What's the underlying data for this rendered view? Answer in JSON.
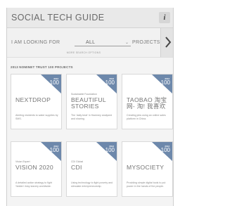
{
  "app": {
    "title": "SOCIAL TECH GUIDE",
    "info_label": "i"
  },
  "filter": {
    "prefix": "I AM LOOKING FOR",
    "selected": "ALL",
    "suffix": "PROJECTS.",
    "more_options": "MORE SEARCH OPTIONS"
  },
  "section": {
    "label": "2013 NOMINET TRUST 100 PROJECTS"
  },
  "colors": {
    "corner_blue": "#6d88ab",
    "title_bar": "#e9e9e9"
  },
  "cards": [
    {
      "org": "",
      "title": "NEXTDROP",
      "desc": "Alerting residents to water supplies by SMS.",
      "rank_year": "2013",
      "rank_num": "100",
      "rank_sub": "NOMINET TRUST"
    },
    {
      "org": "Sustainable Foundation",
      "title": "BEAUTIFUL STORIES",
      "desc": "The 'daily beat' in Hackney analysed and sharing.",
      "rank_year": "2013",
      "rank_num": "100",
      "rank_sub": "NOMINET TRUST"
    },
    {
      "org": "",
      "title": "TAOBAO 淘宝网- 淘! 我喜欢",
      "desc": "Creating jobs using an online sales platform in China.",
      "rank_year": "2013",
      "rank_num": "100",
      "rank_sub": "NOMINET TRUST"
    },
    {
      "org": "Vision Expert",
      "title": "VISION 2020",
      "desc": "A detailed action strategy to fight 'hidden' risky slavery worldwide.",
      "rank_year": "2013",
      "rank_num": "100",
      "rank_sub": "NOMINET TRUST"
    },
    {
      "org": "CDI Global",
      "title": "CDI",
      "desc": "Using technology to fight poverty and stimulate entrepreneurship.",
      "rank_year": "2013",
      "rank_num": "100",
      "rank_sub": "NOMINET TRUST"
    },
    {
      "org": "",
      "title": "MYSOCIETY",
      "desc": "Providing simple digital tools to put power in the hands of the people.",
      "rank_year": "2013",
      "rank_num": "100",
      "rank_sub": "NOMINET TRUST"
    }
  ]
}
